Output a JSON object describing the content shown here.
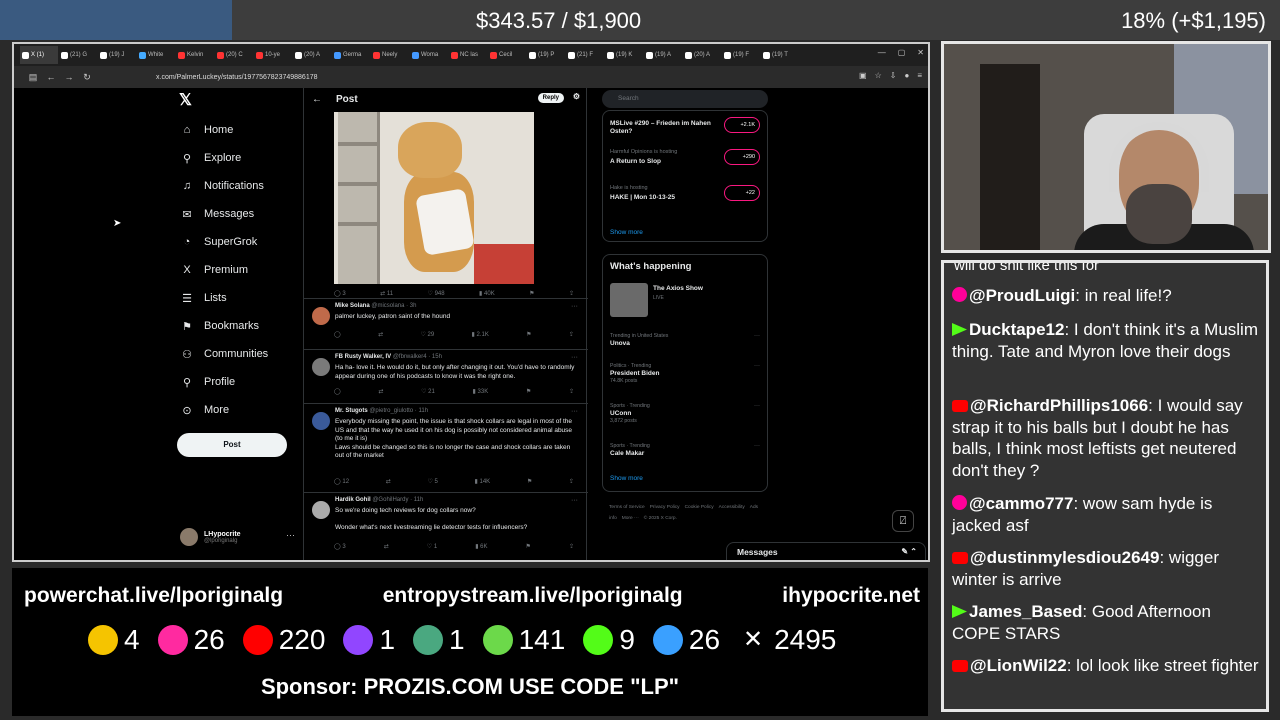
{
  "overlay": {
    "goal": "$343.57 / $1,900",
    "percent": "18% (+$1,195)",
    "links": [
      "powerchat.live/lporiginalg",
      "entropystream.live/lporiginalg",
      "ihypocrite.net"
    ],
    "counts": [
      {
        "icon": "smile-icon",
        "value": "4",
        "color": "#f5c400"
      },
      {
        "icon": "pink-asterisk-icon",
        "value": "26",
        "color": "#ff2aa0"
      },
      {
        "icon": "youtube-icon",
        "value": "220",
        "color": "#ff0000"
      },
      {
        "icon": "twitch-icon",
        "value": "1",
        "color": "#9146ff"
      },
      {
        "icon": "orb-icon",
        "value": "1",
        "color": "#4aa880"
      },
      {
        "icon": "rumble-icon",
        "value": "141",
        "color": "#6cd94a"
      },
      {
        "icon": "kick-icon",
        "value": "9",
        "color": "#53fc18"
      },
      {
        "icon": "moon-icon",
        "value": "26",
        "color": "#3aa0ff"
      },
      {
        "icon": "x-icon",
        "value": "2495",
        "color": "#ffffff"
      }
    ],
    "sponsor": "Sponsor: PROZIS.COM USE CODE \"LP\""
  },
  "browser": {
    "tabs": [
      "X (1)",
      "(21) G",
      "(19) J",
      "White",
      "Kelvin",
      "(20) C",
      "10-ye",
      "(20) A",
      "Germa",
      "Neely",
      "Woma",
      "NC las",
      "Cecil",
      "(19) P",
      "(21) F",
      "(19) K",
      "(19) A",
      "(20) A",
      "(19) F",
      "(19) T"
    ],
    "url": "x.com/PalmerLuckey/status/1977567823749886178"
  },
  "x": {
    "nav": [
      {
        "icon": "home-icon",
        "glyph": "⌂",
        "label": "Home"
      },
      {
        "icon": "explore-icon",
        "glyph": "⚲",
        "label": "Explore"
      },
      {
        "icon": "bell-icon",
        "glyph": "♫",
        "label": "Notifications"
      },
      {
        "icon": "mail-icon",
        "glyph": "✉",
        "label": "Messages"
      },
      {
        "icon": "grok-icon",
        "glyph": "◔",
        "label": "SuperGrok"
      },
      {
        "icon": "x-premium-icon",
        "glyph": "X",
        "label": "Premium"
      },
      {
        "icon": "list-icon",
        "glyph": "☰",
        "label": "Lists"
      },
      {
        "icon": "bookmark-icon",
        "glyph": "⚑",
        "label": "Bookmarks"
      },
      {
        "icon": "people-icon",
        "glyph": "⚇",
        "label": "Communities"
      },
      {
        "icon": "person-icon",
        "glyph": "⚲",
        "label": "Profile"
      },
      {
        "icon": "more-icon",
        "glyph": "⊙",
        "label": "More"
      }
    ],
    "post_button": "Post",
    "account": {
      "name": "LHypocrite",
      "handle": "@lporiginalg"
    },
    "header": {
      "title": "Post",
      "reply": "Reply"
    },
    "main_actions": [
      "3",
      "11",
      "948",
      "40K"
    ],
    "tweets": [
      {
        "name": "Mike Solana",
        "handle": "@micsolana · 3h",
        "text": "palmer luckey, patron saint of the hound",
        "actions": [
          "",
          "",
          "29",
          "2.1K"
        ],
        "avatar": "#c06a4a"
      },
      {
        "name": "FB Rusty Walker, IV",
        "handle": "@fbrwalker4 · 15h",
        "text": "Ha ha- love it. He would do it, but only after changing it out. You'd have to randomly appear during one of his podcasts to know it was the right one.",
        "actions": [
          "",
          "",
          "21",
          "33K"
        ],
        "avatar": "#7a7a7a"
      },
      {
        "name": "Mr. Stugots",
        "handle": "@pietro_giulotto · 11h",
        "text": "Everybody missing the point, the issue is that shock collars are legal in most of the US and that the way he used it on his dog is possibly not considered animal abuse (to me it is)\nLaws should be changed so this is no longer the case and shock collars are taken out of the market",
        "actions": [
          "12",
          "",
          "5",
          "14K"
        ],
        "avatar": "#3a5a9a"
      },
      {
        "name": "Hardik Gohil",
        "handle": "@GohilHardy · 11h",
        "text": "So we're doing tech reviews for dog collars now?\n\nWonder what's next livestreaming lie detector tests for influencers?",
        "actions": [
          "3",
          "",
          "1",
          "6K"
        ],
        "avatar": "#aaaaaa"
      }
    ],
    "search_placeholder": "Search",
    "spaces": [
      {
        "host": "",
        "title": "MSLive #290 – Frieden im Nahen Osten?",
        "count": "+2.1K"
      },
      {
        "host": "Harmful Opinions is hosting",
        "title": "A Return to Slop",
        "count": "+290"
      },
      {
        "host": "Hake is hosting",
        "title": "HAKE | Mon 10-13-25",
        "count": "+22"
      }
    ],
    "show_more": "Show more",
    "happening": {
      "title": "What's happening",
      "axios": {
        "title": "The Axios Show",
        "label": "LIVE"
      },
      "trends": [
        {
          "cat": "Trending in United States",
          "name": "Unova",
          "count": ""
        },
        {
          "cat": "Politics · Trending",
          "name": "President Biden",
          "count": "74.8K posts"
        },
        {
          "cat": "Sports · Trending",
          "name": "UConn",
          "count": "3,872 posts"
        },
        {
          "cat": "Sports · Trending",
          "name": "Cale Makar",
          "count": ""
        }
      ]
    },
    "footer": [
      "Terms of Service",
      "Privacy Policy",
      "Cookie Policy",
      "Accessibility",
      "Ads info",
      "More ···",
      "© 2025 X Corp."
    ],
    "messages_drawer": "Messages"
  },
  "chat": {
    "cutoff": "will do shit like this for",
    "messages": [
      {
        "user": "@ProudLuigi",
        "text": ": in real life!?",
        "badge": "pink"
      },
      {
        "user": "Ducktape12",
        "text": ": I don't think it's a Muslim thing. Tate and Myron love their dogs",
        "badge": "kick"
      },
      {
        "user": "@RichardPhillips1066",
        "text": ": I would say strap it to his balls but I doubt he has balls, I think most leftists get neutered don't they ?",
        "badge": "yt"
      },
      {
        "user": "@cammo777",
        "text": ": wow sam hyde is jacked asf",
        "badge": "pink"
      },
      {
        "user": "@dustinmylesdiou2649",
        "text": ": wigger winter is arrive",
        "badge": "yt"
      },
      {
        "user": "James_Based",
        "text": ": Good Afternoon COPE STARS",
        "badge": "kick"
      },
      {
        "user": "@LionWil22",
        "text": ": lol look like street fighter",
        "badge": "yt"
      }
    ]
  }
}
